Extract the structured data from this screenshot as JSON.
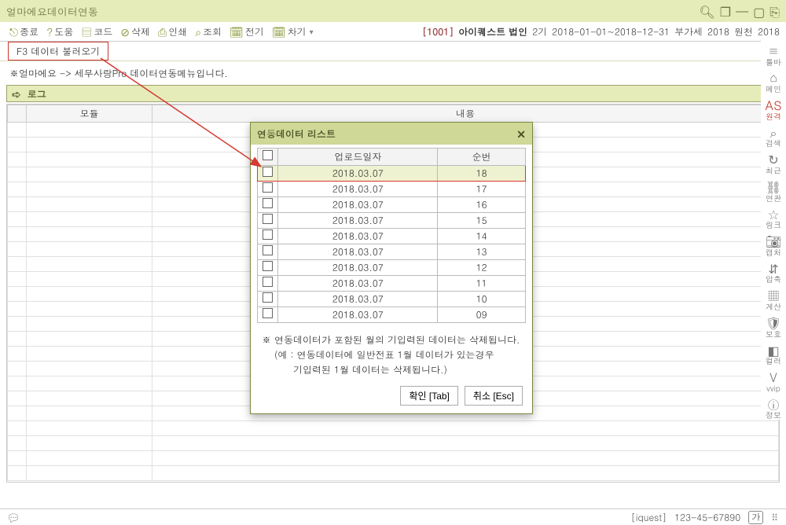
{
  "window": {
    "title": "얼마에요데이터연동"
  },
  "toolbar": {
    "items": [
      {
        "label": "종료"
      },
      {
        "label": "도움"
      },
      {
        "label": "코드"
      },
      {
        "label": "삭제"
      },
      {
        "label": "인쇄"
      },
      {
        "label": "조회"
      },
      {
        "label": "전기"
      },
      {
        "label": "차기"
      }
    ],
    "right": {
      "code": "[1001]",
      "name": "아이퀘스트 법인",
      "period_label": "2기",
      "period": "2018-01-01~2018-12-31",
      "vat_label": "부가세",
      "vat_year": "2018",
      "wht_label": "원천",
      "wht_year": "2018"
    }
  },
  "f3_tab": "F3 데이터 불러오기",
  "description": "※얼마에요 -> 세무사랑Pro   데이터연동메뉴입니다.",
  "log_label": "로그",
  "bg_table": {
    "col_module": "모듈",
    "col_content": "내용"
  },
  "dialog": {
    "title": "연동데이터 리스트",
    "col_upload_date": "업로드일자",
    "col_seq": "순번",
    "rows": [
      {
        "date": "2018.03.07",
        "seq": "18",
        "selected": true
      },
      {
        "date": "2018.03.07",
        "seq": "17"
      },
      {
        "date": "2018.03.07",
        "seq": "16"
      },
      {
        "date": "2018.03.07",
        "seq": "15"
      },
      {
        "date": "2018.03.07",
        "seq": "14"
      },
      {
        "date": "2018.03.07",
        "seq": "13"
      },
      {
        "date": "2018.03.07",
        "seq": "12"
      },
      {
        "date": "2018.03.07",
        "seq": "11"
      },
      {
        "date": "2018.03.07",
        "seq": "10"
      },
      {
        "date": "2018.03.07",
        "seq": "09"
      }
    ],
    "note1": "※ 연동데이터가 포함된 월의 기입력된 데이터는 삭제됩니다.",
    "note2": "(예 : 연동데이터에 일반전표 1월 데이터가 있는경우",
    "note3": "기입력된 1월 데이터는 삭제됩니다.)",
    "ok_label": "확인 [Tab]",
    "cancel_label": "취소 [Esc]"
  },
  "rail": {
    "items": [
      {
        "label": "툴바"
      },
      {
        "label": "메인"
      },
      {
        "label": "원격",
        "selected": true
      },
      {
        "label": "검색"
      },
      {
        "label": "최근"
      },
      {
        "label": "연관"
      },
      {
        "label": "링크"
      },
      {
        "label": "캡처"
      },
      {
        "label": "압축"
      },
      {
        "label": "계산"
      },
      {
        "label": "보호"
      },
      {
        "label": "컬러"
      },
      {
        "label": "vvip"
      },
      {
        "label": "정보"
      }
    ]
  },
  "status": {
    "company": "[iquest]",
    "biz_no": "123-45-67890",
    "ga": "가"
  }
}
